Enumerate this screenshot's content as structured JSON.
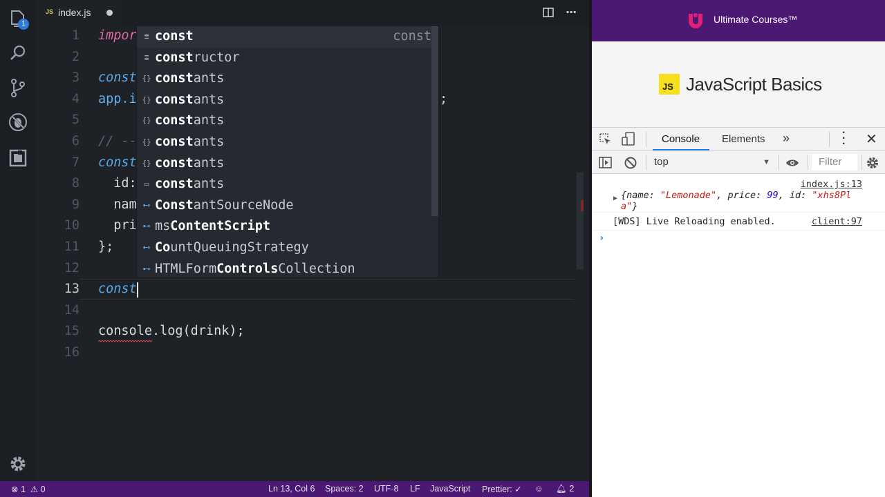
{
  "editor": {
    "tab": {
      "label": "index.js",
      "icon": "JS"
    },
    "explorer_badge": "1",
    "lines": [
      {
        "n": "1",
        "segs": [
          {
            "t": "impor",
            "c": "kwi"
          }
        ]
      },
      {
        "n": "2",
        "segs": []
      },
      {
        "n": "3",
        "segs": [
          {
            "t": "const",
            "c": "kw"
          }
        ]
      },
      {
        "n": "4",
        "segs": [
          {
            "t": "app.i",
            "c": "blue"
          }
        ]
      },
      {
        "n": "5",
        "segs": []
      },
      {
        "n": "6",
        "segs": [
          {
            "t": "// --",
            "c": "cm"
          }
        ]
      },
      {
        "n": "7",
        "segs": [
          {
            "t": "const",
            "c": "kw"
          }
        ]
      },
      {
        "n": "8",
        "segs": [
          {
            "t": "  id:",
            "c": "fn"
          }
        ]
      },
      {
        "n": "9",
        "segs": [
          {
            "t": "  nam",
            "c": "fn"
          }
        ]
      },
      {
        "n": "10",
        "segs": [
          {
            "t": "  pri",
            "c": "fn"
          }
        ]
      },
      {
        "n": "11",
        "segs": [
          {
            "t": "};",
            "c": "fn"
          }
        ]
      },
      {
        "n": "12",
        "segs": []
      },
      {
        "n": "13",
        "segs": [
          {
            "t": "const",
            "c": "kw"
          }
        ],
        "active": true
      },
      {
        "n": "14",
        "segs": []
      },
      {
        "n": "15",
        "segs": [
          {
            "t": "console.log(drink);",
            "c": "fn"
          }
        ]
      },
      {
        "n": "16",
        "segs": []
      }
    ],
    "line4_tail": ";",
    "suggestions": [
      {
        "icon": "keyword",
        "pre": "",
        "match": "const",
        "post": "",
        "detail": "const",
        "selected": true
      },
      {
        "icon": "keyword",
        "pre": "",
        "match": "const",
        "post": "ructor",
        "detail": ""
      },
      {
        "icon": "module",
        "pre": "",
        "match": "const",
        "post": "ants",
        "detail": ""
      },
      {
        "icon": "module",
        "pre": "",
        "match": "const",
        "post": "ants",
        "detail": ""
      },
      {
        "icon": "module",
        "pre": "",
        "match": "const",
        "post": "ants",
        "detail": ""
      },
      {
        "icon": "module",
        "pre": "",
        "match": "const",
        "post": "ants",
        "detail": ""
      },
      {
        "icon": "module",
        "pre": "",
        "match": "const",
        "post": "ants",
        "detail": ""
      },
      {
        "icon": "text",
        "pre": "",
        "match": "const",
        "post": "ants",
        "detail": ""
      },
      {
        "icon": "variable",
        "pre": "",
        "match": "Const",
        "post": "antSourceNode",
        "detail": ""
      },
      {
        "icon": "variable",
        "pre": "ms",
        "match": "ContentScript",
        "post": "",
        "detail": "",
        "mixed": true
      },
      {
        "icon": "variable",
        "pre": "",
        "match": "Co",
        "post": "untQueuingStrategy",
        "detail": "",
        "mixed2": true
      },
      {
        "icon": "variable",
        "pre": "HTMLForm",
        "match": "Controls",
        "post": "Collection",
        "detail": ""
      }
    ]
  },
  "status_bar": {
    "errors": "1",
    "warnings": "0",
    "position": "Ln 13, Col 6",
    "spaces": "Spaces: 2",
    "encoding": "UTF-8",
    "eol": "LF",
    "language": "JavaScript",
    "prettier": "Prettier: ✓",
    "notifications": "2"
  },
  "browser": {
    "brand": "Ultimate Courses™",
    "course_badge": "JS",
    "course_title": "JavaScript Basics",
    "devtools": {
      "tabs": [
        "Console",
        "Elements"
      ],
      "context": "top",
      "filter_placeholder": "Filter",
      "messages": [
        {
          "source": "index.js:13",
          "obj_line1": "{name: \"Lemonade\", price: 99, id: \"xhs8Pl",
          "obj_line2": "a\"}"
        },
        {
          "source": "client:97",
          "text": "[WDS] Live Reloading enabled."
        }
      ]
    }
  },
  "colors": {
    "status_bar": "#4b1873",
    "brand_bar": "#4b1873",
    "accent_blue": "#1a73e8",
    "js_yellow": "#f7df1e"
  }
}
